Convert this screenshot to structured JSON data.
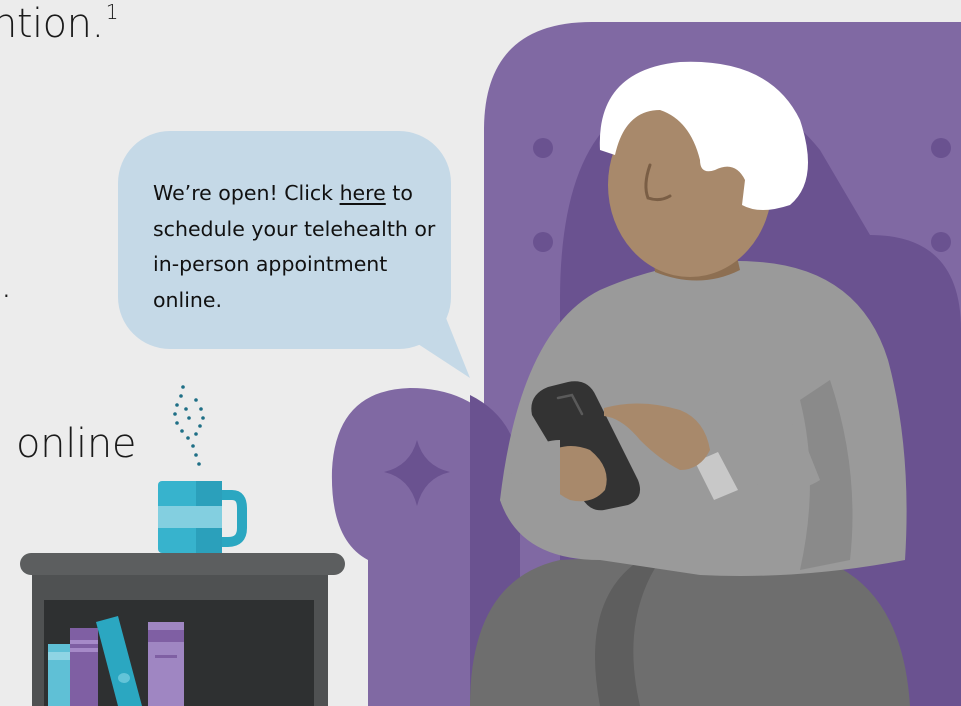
{
  "intro": {
    "heading_fragment": "ntion.",
    "footnote": "1",
    "bullet_fragment": ".",
    "online_fragment": "online"
  },
  "bubble": {
    "text_before_link": "We’re open! Click ",
    "link_label": "here",
    "text_after_link": " to schedule your telehealth or in-person appointment online."
  },
  "colors": {
    "background": "#ececec",
    "chair": "#8069a3",
    "chair_shadow": "#6a5290",
    "bubble": "#c5d9e7",
    "sweater": "#9a9a9a",
    "pants": "#6e6e6e",
    "skin": "#a8896b",
    "hair": "#ffffff",
    "mug": "#37b3cd",
    "table": "#4f5152"
  }
}
